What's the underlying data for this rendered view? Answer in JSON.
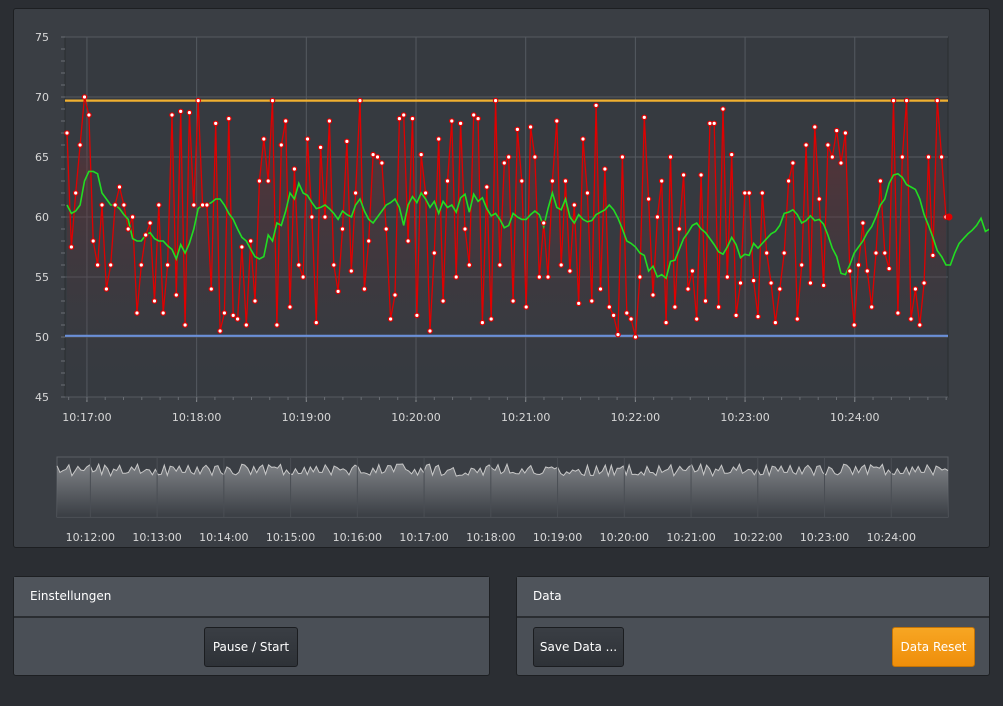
{
  "chart_data": [
    {
      "type": "line",
      "title": "",
      "xlabel": "",
      "ylabel": "",
      "ylim": [
        45,
        75
      ],
      "yticks": [
        45,
        50,
        55,
        60,
        65,
        70,
        75
      ],
      "xrange": [
        "10:16:48",
        "10:24:51"
      ],
      "xticks": [
        "10:17:00",
        "10:18:00",
        "10:19:00",
        "10:20:00",
        "10:21:00",
        "10:22:00",
        "10:23:00",
        "10:24:00"
      ],
      "grid": true,
      "colors": {
        "raw": "#e00000",
        "average": "#22dd22",
        "upper_limit": "#f0b030",
        "lower_limit": "#6a8fd8",
        "background": "#3a3e44"
      },
      "series": [
        {
          "values": [
            67,
            57.5,
            62,
            66,
            70,
            68.5,
            58,
            56,
            61,
            54,
            56,
            61,
            62.5,
            61,
            59,
            60,
            52,
            56,
            58.5,
            59.5,
            53,
            61,
            52,
            56,
            68.5,
            53.5,
            68.8,
            51,
            68.7,
            61,
            69.7,
            61,
            61,
            54,
            67.8,
            50.5,
            52,
            68.2,
            51.8,
            51.5,
            57.5,
            51,
            58,
            53,
            63,
            66.5,
            63,
            69.7,
            51,
            66,
            68,
            52.5,
            64,
            56,
            55,
            66.5,
            60,
            51.2,
            65.8,
            60,
            68,
            56,
            53.8,
            59,
            66.3,
            55.5,
            62,
            69.7,
            54,
            58,
            65.2,
            65,
            64.5,
            59,
            51.5,
            53.5,
            68.2,
            68.5,
            58,
            68.2,
            51.8,
            65.2,
            62,
            50.5,
            57,
            66.5,
            53,
            63,
            68,
            55,
            67.8,
            59,
            56,
            68.5,
            68.2,
            51.2,
            62.5,
            51.5,
            69.7,
            56,
            64.5,
            65,
            53,
            67.3,
            63,
            52.5,
            67.5,
            65,
            55,
            59.5,
            55,
            63,
            68,
            56,
            63,
            55.5,
            61,
            52.8,
            66.5,
            62,
            53,
            69.3,
            54,
            64,
            52.5,
            51.8,
            50.2,
            65,
            52,
            51.5,
            50,
            55,
            68.3,
            61.5,
            53.5,
            60,
            63,
            51.2,
            65,
            52.5,
            59,
            63.5,
            54,
            55.5,
            51.5,
            63.5,
            53,
            67.8,
            67.8,
            52.5,
            69,
            55,
            65.2,
            51.8,
            54.5,
            62,
            62,
            54.7,
            51.7,
            62,
            57,
            54.5,
            51.2,
            54,
            57,
            63,
            64.5,
            51.5,
            56,
            66,
            54.5,
            67.5,
            61.5,
            54.3,
            66,
            65,
            67.2,
            64.5,
            67,
            55.5,
            51,
            56,
            59.5,
            55.5,
            52.5,
            57,
            63,
            57,
            55.7,
            69.7,
            52,
            65,
            69.7,
            51.5,
            54,
            51,
            54.5,
            65,
            56.8,
            69.7,
            65,
            60
          ],
          "role": "raw"
        },
        {
          "values": [
            61,
            60.3,
            60.5,
            61,
            63,
            63.8,
            63.8,
            63.6,
            62,
            61.5,
            61,
            61,
            60.7,
            60.2,
            59.8,
            58.2,
            58,
            58,
            58.5,
            58.7,
            58.2,
            58,
            58,
            57.6,
            57.3,
            56.5,
            57.7,
            57,
            57.8,
            59,
            60.7,
            61,
            61,
            61.2,
            61.5,
            61.5,
            61,
            60.3,
            59.8,
            59,
            58.3,
            58,
            57.3,
            56.7,
            56.5,
            56.7,
            58.5,
            58,
            59.5,
            59.3,
            60.5,
            62,
            61.5,
            62.8,
            62,
            61.8,
            61.2,
            60.7,
            60.8,
            61,
            60.7,
            60.3,
            59.8,
            60.5,
            60.2,
            60,
            61,
            61.5,
            60.5,
            59.8,
            59.5,
            60,
            60.5,
            61,
            61.2,
            61.5,
            60.8,
            59.3,
            61,
            61.7,
            61.2,
            62,
            61.5,
            60.8,
            61.3,
            60.3,
            61.3,
            60.8,
            61,
            60.4,
            61.6,
            61.9,
            60.4,
            61.9,
            61.3,
            61.6,
            60.7,
            60.1,
            60.3,
            59.8,
            59.1,
            59.3,
            60.3,
            60,
            59.8,
            59.8,
            60.2,
            60.5,
            60.2,
            59.2,
            60.7,
            62,
            60.8,
            60.6,
            61.5,
            60,
            59.5,
            60.2,
            59.8,
            59.6,
            59.7,
            60.2,
            60.4,
            60.6,
            61,
            60.6,
            59.9,
            59,
            58,
            57.8,
            57.5,
            57,
            56.8,
            55.5,
            55.9,
            55,
            55.2,
            54.9,
            56.3,
            56.4,
            57.3,
            58.2,
            58.7,
            59.3,
            59.5,
            59,
            58.7,
            58.2,
            57.7,
            57.1,
            56.9,
            57.5,
            58.3,
            57.7,
            56.6,
            56.9,
            56.8,
            57.8,
            57.4,
            57.8,
            58.2,
            58.6,
            58.8,
            59.3,
            60.3,
            60.4,
            60.6,
            60.2,
            59.5,
            59.7,
            60.1,
            59.7,
            59.8,
            59.4,
            58.5,
            57.4,
            56.7,
            55.3,
            55.2,
            56,
            57,
            57.5,
            58,
            58.7,
            59.2,
            60,
            61,
            61.5,
            62.8,
            63.5,
            63.6,
            63.3,
            62.7,
            62.5,
            62.3,
            61.5,
            60.2,
            59.3,
            58.3,
            57.2,
            56.7,
            56,
            56,
            57,
            57.8,
            58.2,
            58.6,
            58.9,
            59.3,
            59.9,
            58.8,
            59,
            59.8,
            60.3,
            60.8,
            61.3
          ],
          "role": "average"
        }
      ],
      "reference_lines": [
        {
          "y": 69.7,
          "color": "#f0b030"
        },
        {
          "y": 50.1,
          "color": "#6a8fd8"
        }
      ]
    },
    {
      "type": "area",
      "title": "",
      "xrange": [
        "10:11:30",
        "10:24:51"
      ],
      "xticks": [
        "10:12:00",
        "10:13:00",
        "10:14:00",
        "10:15:00",
        "10:16:00",
        "10:17:00",
        "10:18:00",
        "10:19:00",
        "10:20:00",
        "10:21:00",
        "10:22:00",
        "10:23:00",
        "10:24:00"
      ],
      "ylim": [
        45,
        75
      ],
      "note_values": "navigator overview of the full raw series",
      "color": "#c8c8c8"
    }
  ],
  "panels": {
    "settings": {
      "title": "Einstellungen",
      "pause_label": "Pause / Start"
    },
    "data": {
      "title": "Data",
      "save_label": "Save Data ...",
      "reset_label": "Data Reset"
    }
  }
}
